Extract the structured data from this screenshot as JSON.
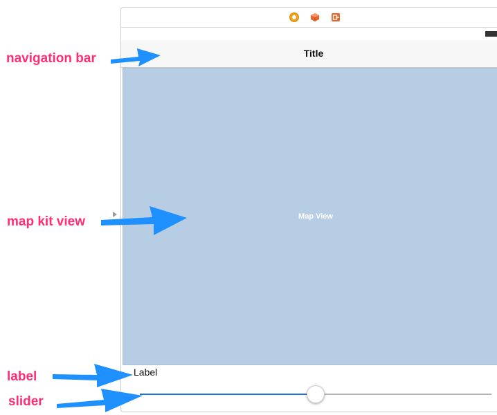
{
  "scene": {
    "dock_icons": [
      "view-controller-icon",
      "first-responder-icon",
      "exit-icon"
    ],
    "navigation_bar": {
      "title": "Title"
    },
    "map_view": {
      "caption": "Map View"
    },
    "label": {
      "text": "Label"
    },
    "slider": {
      "value": 0.5
    }
  },
  "annotations": {
    "navigation_bar": "navigation bar",
    "map_kit_view": "map kit view",
    "label": "label",
    "slider": "slider"
  },
  "colors": {
    "annotation_text": "#ff2d75",
    "annotation_arrow": "#1e90ff",
    "map_fill": "#b7cde4",
    "slider_min_track": "#1a73d9"
  }
}
